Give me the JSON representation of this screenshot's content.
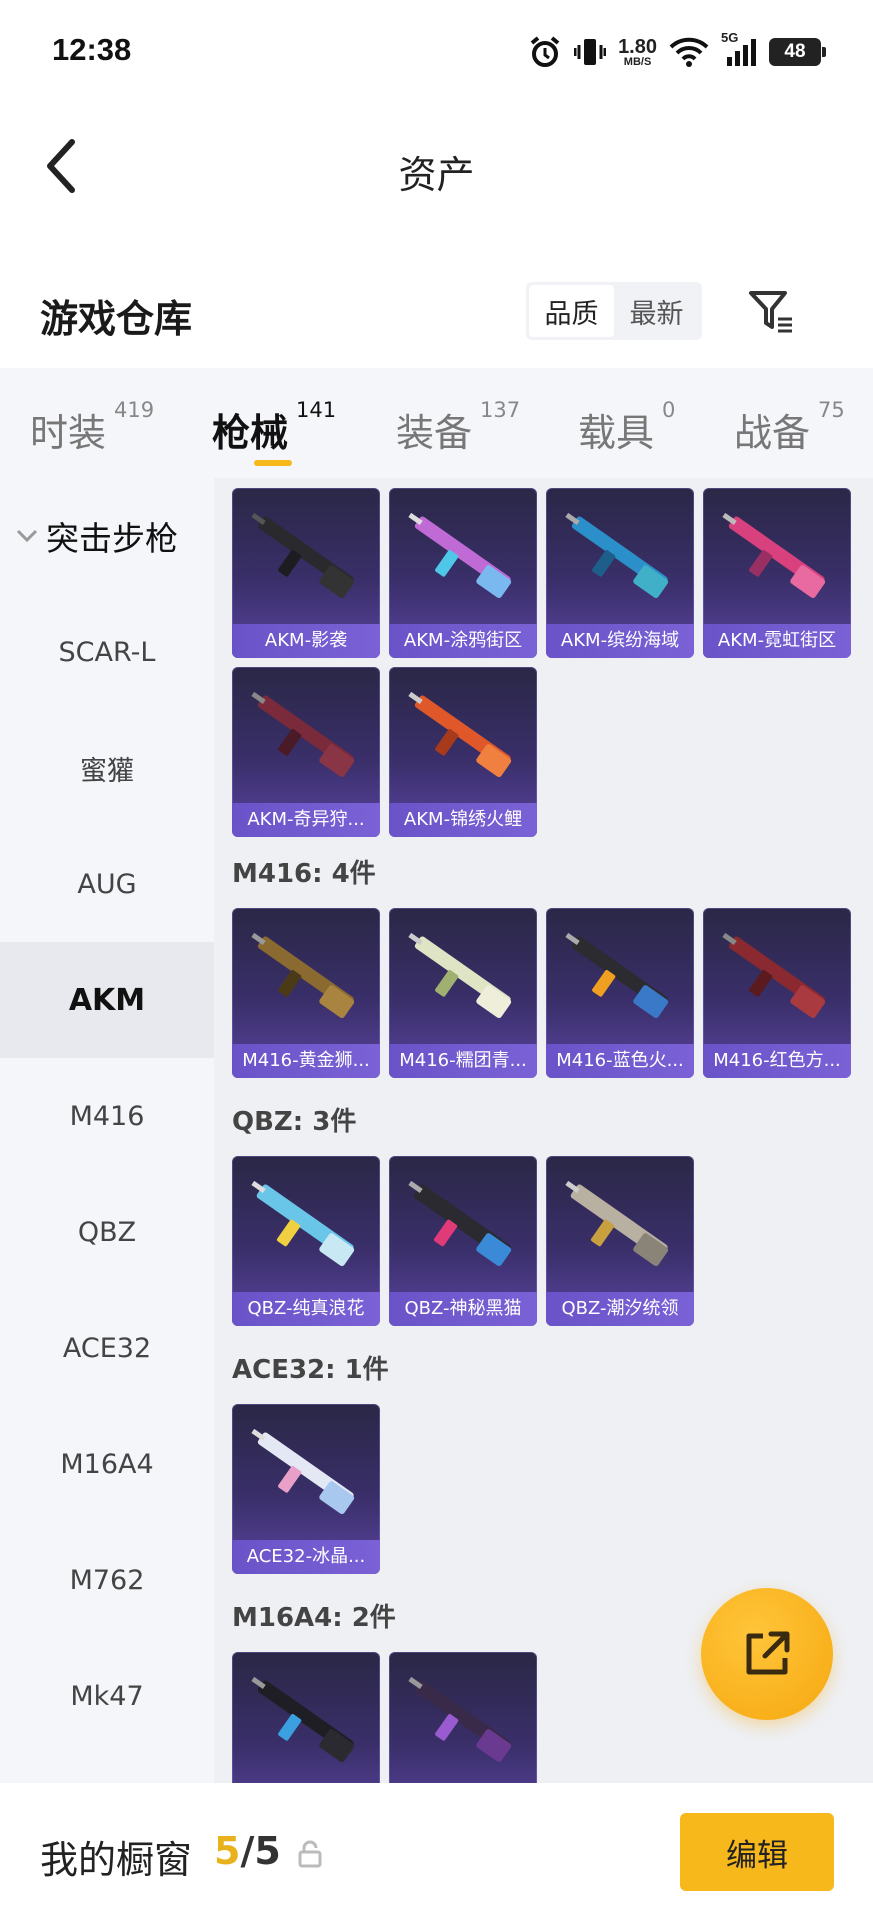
{
  "status_bar": {
    "time": "12:38",
    "net_speed_value": "1.80",
    "net_speed_unit": "MB/S",
    "signal_label": "5G",
    "battery_level": "48",
    "icons": [
      "alarm-icon",
      "vibrate-icon",
      "wifi-icon",
      "signal-icon",
      "battery-icon"
    ]
  },
  "header": {
    "title": "资产",
    "back_icon": "chevron-left-icon"
  },
  "warehouse": {
    "title": "游戏仓库",
    "sort_options": [
      "品质",
      "最新"
    ],
    "sort_selected": "品质",
    "filter_icon": "filter-icon"
  },
  "tabs": [
    {
      "label": "时装",
      "count": "419"
    },
    {
      "label": "枪械",
      "count": "141"
    },
    {
      "label": "装备",
      "count": "137"
    },
    {
      "label": "载具",
      "count": "0"
    },
    {
      "label": "战备",
      "count": "75"
    }
  ],
  "active_tab": "枪械",
  "sidebar": {
    "group_label": "突击步枪",
    "items": [
      "SCAR-L",
      "蜜獾",
      "AUG",
      "AKM",
      "M416",
      "QBZ",
      "ACE32",
      "M16A4",
      "M762",
      "Mk47"
    ],
    "active_item": "AKM"
  },
  "sections": [
    {
      "title": "",
      "items": [
        "AKM-影袭",
        "AKM-涂鸦街区",
        "AKM-缤纷海域",
        "AKM-霓虹街区",
        "AKM-奇异狩...",
        "AKM-锦绣火鲤"
      ]
    },
    {
      "title": "M416: 4件",
      "items": [
        "M416-黄金狮...",
        "M416-糯团青...",
        "M416-蓝色火...",
        "M416-红色方..."
      ]
    },
    {
      "title": "QBZ: 3件",
      "items": [
        "QBZ-纯真浪花",
        "QBZ-神秘黑猫",
        "QBZ-潮汐统领"
      ]
    },
    {
      "title": "ACE32: 1件",
      "items": [
        "ACE32-冰晶..."
      ]
    },
    {
      "title": "M16A4: 2件",
      "items": [
        "",
        ""
      ]
    }
  ],
  "colors": {
    "accent": "#f6b81b",
    "card_bg": "#3a2f6a",
    "card_label_bg": "#6a53c8",
    "page_bg": "#eef0f4"
  },
  "bottom_bar": {
    "title": "我的橱窗",
    "count_current": "5",
    "count_sep": "/",
    "count_total": "5",
    "edit_label": "编辑"
  },
  "fab_icon": "share-external-icon"
}
